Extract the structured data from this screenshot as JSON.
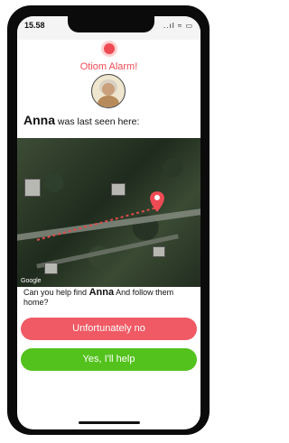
{
  "status_bar": {
    "time": "15.58",
    "icons": "..ıl ≈ ▭"
  },
  "alarm": {
    "title": "Otiom Alarm!",
    "accent_color": "#ef4b55"
  },
  "last_seen": {
    "name": "Anna",
    "suffix": " was last seen here:"
  },
  "map": {
    "attribution": "Google",
    "marker_icon": "map-pin-icon"
  },
  "prompt": {
    "prefix": "Can you help find ",
    "name": "Anna",
    "suffix": " And follow them home?"
  },
  "buttons": {
    "decline_label": "Unfortunately no",
    "accept_label": "Yes, I'll help",
    "decline_color": "#f05a64",
    "accept_color": "#53c21c"
  }
}
